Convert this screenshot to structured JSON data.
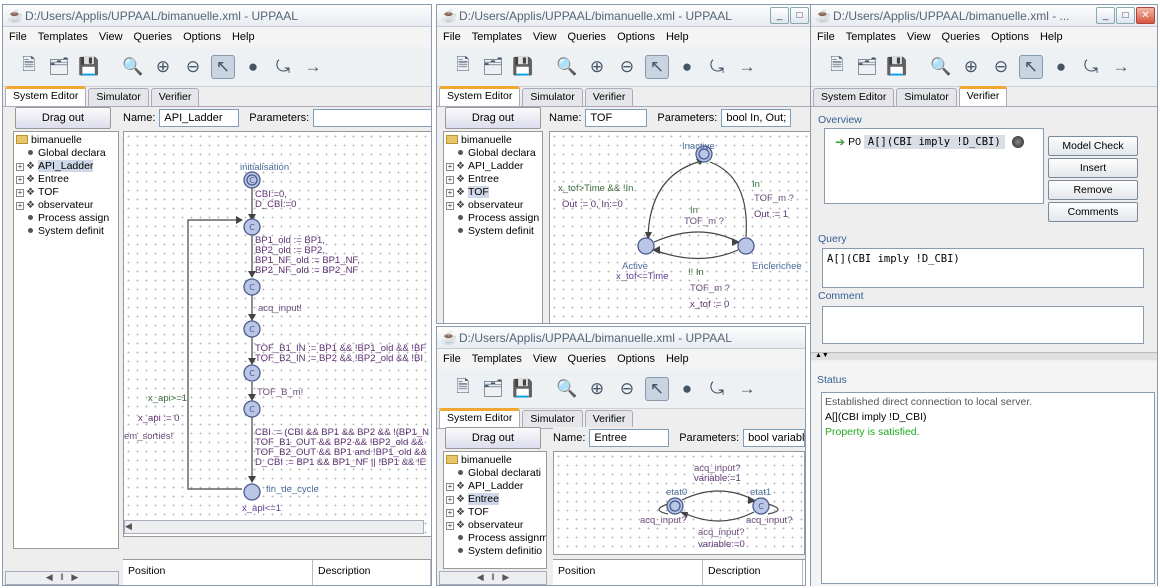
{
  "left_window": {
    "title": "D:/Users/Applis/UPPAAL/bimanuelle.xml - UPPAAL",
    "menu": [
      "File",
      "Templates",
      "View",
      "Queries",
      "Options",
      "Help"
    ],
    "tabs": [
      "System Editor",
      "Simulator",
      "Verifier"
    ],
    "drag_out": "Drag out",
    "name_label": "Name:",
    "name_value": "API_Ladder",
    "params_label": "Parameters:",
    "params_value": "",
    "tree": {
      "root": "bimanuelle",
      "items": [
        "Global declara",
        "API_Ladder",
        "Entree",
        "TOF",
        "observateur",
        "Process assign",
        "System definit"
      ]
    },
    "bottom": {
      "position": "Position",
      "description": "Description"
    },
    "automaton": {
      "initialisation": "initialisation",
      "init_update1": "CBI:=0,",
      "init_update2": "D_CBI:=0",
      "upd1": "BP1_old := BP1,",
      "upd2": "BP2_old := BP2,",
      "upd3": "BP1_NF_old := BP1_NF,",
      "upd4": "BP2_NF_old := BP2_NF",
      "acq": "acq_input!",
      "tof1": "TOF_B1_IN := BP1 && !BP1_old && !BF",
      "tof2": "TOF_B2_IN := BP2 && !BP2_old && !BI",
      "tofbm": "TOF_B_m!",
      "cbi1": "CBI := (CBI && BP1 && BP2 && !(BP1_N",
      "cbi2": "TOF_B1_OUT && BP2 && !BP2_old &&",
      "cbi3": "TOF_B2_OUT && BP1 and !BP1_old &&",
      "cbi4": "D_CBI := BP1 && BP1_NF || !BP1 && !E",
      "fin": "fin_de_cycle",
      "xapi_guard": "x_api>=1",
      "xapi_reset": "x_api := 0",
      "sorties": "em_sorties!",
      "xapi_inv": "x_api<=1"
    }
  },
  "tof_window": {
    "title": "D:/Users/Applis/UPPAAL/bimanuelle.xml - UPPAAL",
    "menu": [
      "File",
      "Templates",
      "View",
      "Queries",
      "Options",
      "Help"
    ],
    "tabs": [
      "System Editor",
      "Simulator",
      "Verifier"
    ],
    "drag_out": "Drag out",
    "name_label": "Name:",
    "name_value": "TOF",
    "params_label": "Parameters:",
    "params_value": "bool In, Out;",
    "tree": {
      "root": "bimanuelle",
      "items": [
        "Global declara",
        "API_Ladder",
        "Entree",
        "TOF",
        "observateur",
        "Process assign",
        "System definit"
      ]
    },
    "automaton": {
      "inactive": "Inactive",
      "active": "Active",
      "active_inv": "x_tof<=Time",
      "enclenchee": "Enclenchee",
      "g1": "x_tof>Time && !In",
      "u1": "Out := 0, In:=0",
      "in1": "In",
      "tofm1": "TOF_m ?",
      "in2": "In",
      "tofm2": "TOF_m ?",
      "out1": "Out := 1",
      "nin": "!! In",
      "tofm3": "TOF_m ?",
      "xreset": "x_tof := 0"
    }
  },
  "entree_window": {
    "title": "D:/Users/Applis/UPPAAL/bimanuelle.xml - UPPAAL",
    "menu": [
      "File",
      "Templates",
      "View",
      "Queries",
      "Options",
      "Help"
    ],
    "tabs": [
      "System Editor",
      "Simulator",
      "Verifier"
    ],
    "drag_out": "Drag out",
    "name_label": "Name:",
    "name_value": "Entree",
    "params_label": "Parameters:",
    "params_value": "bool variable",
    "tree": {
      "root": "bimanuelle",
      "items": [
        "Global declarati",
        "API_Ladder",
        "Entree",
        "TOF",
        "observateur",
        "Process assignm",
        "System definitio"
      ]
    },
    "bottom": {
      "position": "Position",
      "description": "Description"
    },
    "automaton": {
      "etat0": "etat0",
      "etat1": "etat1",
      "acq_top": "acq_input?",
      "var1": "variable:=1",
      "acq_left": "acq_input?",
      "acq_right": "acq_input?",
      "acq_bot": "acq_input?",
      "var0": "variable:=0"
    }
  },
  "verifier_window": {
    "title": "D:/Users/Applis/UPPAAL/bimanuelle.xml - ...",
    "menu": [
      "File",
      "Templates",
      "View",
      "Queries",
      "Options",
      "Help"
    ],
    "tabs": [
      "System Editor",
      "Simulator",
      "Verifier"
    ],
    "overview": "Overview",
    "query_id": "P0",
    "query_text": "A[](CBI imply !D_CBI)",
    "buttons": [
      "Model Check",
      "Insert",
      "Remove",
      "Comments"
    ],
    "query_label": "Query",
    "query_value": "A[](CBI imply !D_CBI)",
    "comment_label": "Comment",
    "status_label": "Status",
    "status_lines": [
      "Established direct connection to local server.",
      "A[](CBI imply !D_CBI)",
      "Property is satisfied."
    ],
    "status_colors": [
      "#555555",
      "#000000",
      "#22aa22"
    ]
  }
}
